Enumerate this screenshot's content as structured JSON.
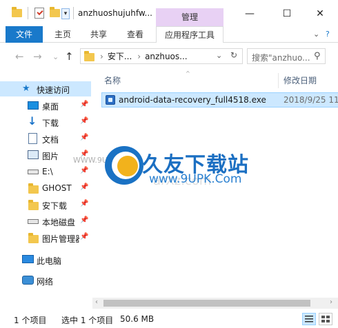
{
  "window": {
    "title": "anzhuoshujuhfw...",
    "context_tab": "管理",
    "controls": {
      "minimize": "—",
      "maximize": "☐",
      "close": "✕"
    },
    "dropdown_glyph": "▾"
  },
  "ribbon": {
    "file": "文件",
    "tabs": [
      "主页",
      "共享",
      "查看"
    ],
    "active_context_tab": "应用程序工具",
    "expand_glyph": "⌄",
    "help_glyph": "?"
  },
  "address": {
    "back": "←",
    "forward": "→",
    "recent": "⌄",
    "up": "↑",
    "crumbs": [
      "安下...",
      "anzhuos..."
    ],
    "sep": "›",
    "dropdown": "⌄",
    "refresh": "↻",
    "search_placeholder": "搜索\"anzhuo...",
    "search_icon": "⚲"
  },
  "sidebar": {
    "quick_access": "快速访问",
    "items": [
      {
        "label": "桌面",
        "icon": "desktop-icon",
        "pinned": true
      },
      {
        "label": "下载",
        "icon": "download-icon",
        "pinned": true
      },
      {
        "label": "文档",
        "icon": "document-icon",
        "pinned": true
      },
      {
        "label": "图片",
        "icon": "picture-icon",
        "pinned": true
      },
      {
        "label": "E:\\",
        "icon": "drive-icon",
        "pinned": true
      },
      {
        "label": "GHOST",
        "icon": "folder-icon",
        "pinned": true
      },
      {
        "label": "安下载",
        "icon": "folder-icon",
        "pinned": true
      },
      {
        "label": "本地磁盘",
        "icon": "drive-icon",
        "pinned": true
      },
      {
        "label": "图片管理器",
        "icon": "folder-icon",
        "pinned": true
      }
    ],
    "this_pc": "此电脑",
    "network": "网络",
    "pin_glyph": "📌"
  },
  "content": {
    "columns": {
      "name": "名称",
      "modified": "修改日期"
    },
    "sort_glyph": "^",
    "files": [
      {
        "name": "android-data-recovery_full4518.exe",
        "modified": "2018/9/25 11"
      }
    ]
  },
  "watermark": {
    "title": "久友下载站",
    "url": "www.9UPK.Com",
    "small": "WWW.9UPK.COM",
    "ghost": "arXz.com"
  },
  "scrollbar": {
    "left": "‹",
    "right": "›"
  },
  "status": {
    "items_count": "1 个项目",
    "selected": "选中 1 个项目",
    "size": "50.6 MB"
  },
  "colors": {
    "accent": "#1979ca",
    "selection": "#cce8ff",
    "context": "#e8d1f4"
  }
}
